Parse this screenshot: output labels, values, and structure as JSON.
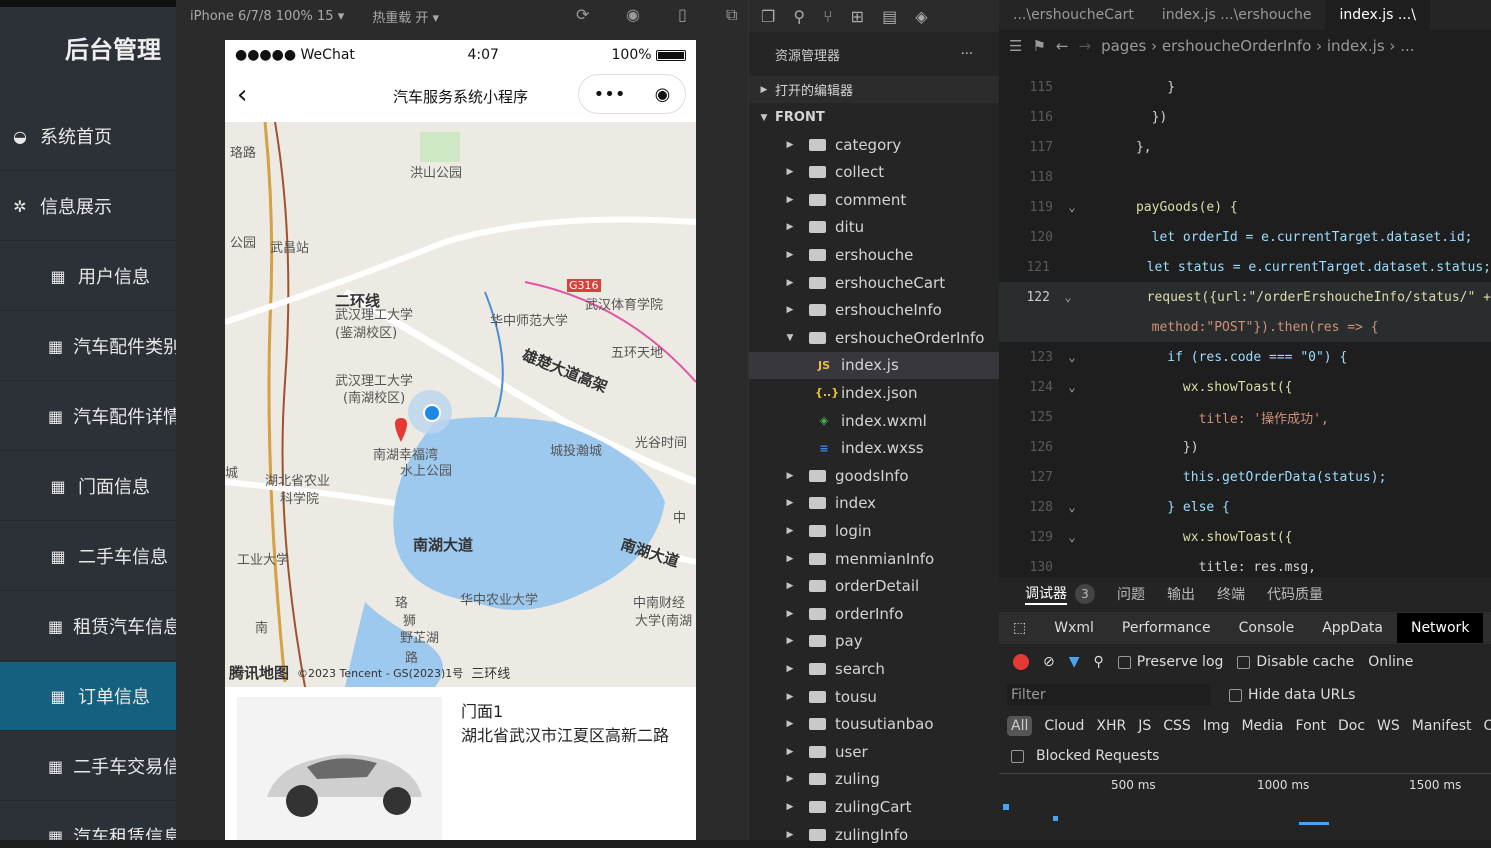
{
  "admin": {
    "title": "后台管理",
    "menu": [
      {
        "label": "系统首页",
        "icon": "dashboard-icon"
      },
      {
        "label": "信息展示",
        "icon": "puzzle-icon"
      },
      {
        "label": "用户信息",
        "icon": "table-icon"
      },
      {
        "label": "汽车配件类别",
        "icon": "table-icon"
      },
      {
        "label": "汽车配件详情",
        "icon": "table-icon"
      },
      {
        "label": "门面信息",
        "icon": "table-icon"
      },
      {
        "label": "二手车信息",
        "icon": "table-icon"
      },
      {
        "label": "租赁汽车信息",
        "icon": "table-icon"
      },
      {
        "label": "订单信息",
        "icon": "table-icon",
        "active": true
      },
      {
        "label": "二手车交易信息",
        "icon": "table-icon"
      },
      {
        "label": "汽车租赁信息",
        "icon": "table-icon"
      }
    ]
  },
  "simulator": {
    "device": "iPhone 6/7/8 100% 15 ▾",
    "hotreload": "热重载 开 ▾"
  },
  "phone": {
    "carrier": "●●●●● WeChat",
    "time": "4:07",
    "battery": "100%",
    "nav_title": "汽车服务系统小程序",
    "map_labels": [
      "洪山公园",
      "武昌站",
      "二环线",
      "武汉理工大学",
      "(鉴湖校区)",
      "华中师范大学",
      "G316",
      "武汉体育学院",
      "雄楚大道高架",
      "五环天地",
      "武汉理工大学",
      "(南湖校区)",
      "南湖幸福湾",
      "水上公园",
      "城投瀚城",
      "光谷时间",
      "湖北省农业",
      "科学院",
      "南湖大道",
      "南湖大道",
      "华中农业大学",
      "中南财经",
      "大学(南湖",
      "野芷湖",
      "工业大学",
      "珞",
      "狮",
      "南",
      "路",
      "公园",
      "珞路",
      "城",
      "中"
    ],
    "map_brand": "腾讯地图",
    "map_copyright": "©2023 Tencent - GS(2023)1号",
    "map_road_bottom": "三环线",
    "store_name": "门面1",
    "store_address": "湖北省武汉市江夏区高新二路"
  },
  "explorer": {
    "title": "资源管理器",
    "open_editors": "打开的编辑器",
    "root": "FRONT",
    "items": [
      {
        "label": "category",
        "type": "folder",
        "open": false,
        "depth": 1
      },
      {
        "label": "collect",
        "type": "folder",
        "open": false,
        "depth": 1
      },
      {
        "label": "comment",
        "type": "folder",
        "open": false,
        "depth": 1
      },
      {
        "label": "ditu",
        "type": "folder",
        "open": false,
        "depth": 1
      },
      {
        "label": "ershouche",
        "type": "folder",
        "open": false,
        "depth": 1
      },
      {
        "label": "ershoucheCart",
        "type": "folder",
        "open": false,
        "depth": 1
      },
      {
        "label": "ershoucheInfo",
        "type": "folder",
        "open": false,
        "depth": 1
      },
      {
        "label": "ershoucheOrderInfo",
        "type": "folder",
        "open": true,
        "depth": 1
      },
      {
        "label": "index.js",
        "type": "js",
        "depth": 2,
        "selected": true
      },
      {
        "label": "index.json",
        "type": "json",
        "depth": 2
      },
      {
        "label": "index.wxml",
        "type": "wxml",
        "depth": 2
      },
      {
        "label": "index.wxss",
        "type": "wxss",
        "depth": 2
      },
      {
        "label": "goodsInfo",
        "type": "folder",
        "open": false,
        "depth": 1
      },
      {
        "label": "index",
        "type": "folder",
        "open": false,
        "depth": 1
      },
      {
        "label": "login",
        "type": "folder",
        "open": false,
        "depth": 1
      },
      {
        "label": "menmianInfo",
        "type": "folder",
        "open": false,
        "depth": 1
      },
      {
        "label": "orderDetail",
        "type": "folder",
        "open": false,
        "depth": 1
      },
      {
        "label": "orderInfo",
        "type": "folder",
        "open": false,
        "depth": 1
      },
      {
        "label": "pay",
        "type": "folder",
        "open": false,
        "depth": 1
      },
      {
        "label": "search",
        "type": "folder",
        "open": false,
        "depth": 1
      },
      {
        "label": "tousu",
        "type": "folder",
        "open": false,
        "depth": 1
      },
      {
        "label": "tousutianbao",
        "type": "folder",
        "open": false,
        "depth": 1
      },
      {
        "label": "user",
        "type": "folder",
        "open": false,
        "depth": 1
      },
      {
        "label": "zuling",
        "type": "folder",
        "open": false,
        "depth": 1
      },
      {
        "label": "zulingCart",
        "type": "folder",
        "open": false,
        "depth": 1
      },
      {
        "label": "zulingInfo",
        "type": "folder",
        "open": false,
        "depth": 1
      }
    ]
  },
  "editor": {
    "tabs": [
      {
        "label": "...\\ershoucheCart"
      },
      {
        "label": "index.js ...\\ershouche"
      },
      {
        "label": "index.js ...\\",
        "active": true
      }
    ],
    "breadcrumb": [
      "pages",
      "ershoucheOrderInfo",
      "index.js",
      "..."
    ],
    "lines": [
      {
        "n": "115",
        "code": "          }"
      },
      {
        "n": "116",
        "code": "        })"
      },
      {
        "n": "117",
        "code": "      },"
      },
      {
        "n": "118",
        "code": ""
      },
      {
        "n": "119",
        "code": "      payGoods(e) {",
        "fold": true
      },
      {
        "n": "120",
        "code": "        let orderId = e.currentTarget.dataset.id;"
      },
      {
        "n": "121",
        "code": "        let status = e.currentTarget.dataset.status;"
      },
      {
        "n": "122",
        "code": "        request({url:\"/orderErshoucheInfo/status/\" +",
        "fold": true,
        "current": true
      },
      {
        "n": "",
        "code": "        method:\"POST\"}).then(res => {",
        "current": true
      },
      {
        "n": "123",
        "code": "          if (res.code === \"0\") {",
        "fold": true
      },
      {
        "n": "124",
        "code": "            wx.showToast({",
        "fold": true
      },
      {
        "n": "125",
        "code": "              title: '操作成功',"
      },
      {
        "n": "126",
        "code": "            })"
      },
      {
        "n": "127",
        "code": "            this.getOrderData(status);"
      },
      {
        "n": "128",
        "code": "          } else {",
        "fold": true
      },
      {
        "n": "129",
        "code": "            wx.showToast({",
        "fold": true
      },
      {
        "n": "130",
        "code": "              title: res.msg,"
      }
    ]
  },
  "devtools": {
    "tabs": [
      "调试器",
      "3",
      "问题",
      "输出",
      "终端",
      "代码质量"
    ],
    "panels": [
      "Wxml",
      "Performance",
      "Console",
      "AppData",
      "Network"
    ],
    "active_panel": "Network",
    "preserve_log": "Preserve log",
    "disable_cache": "Disable cache",
    "online": "Online",
    "filter_placeholder": "Filter",
    "hide_data_urls": "Hide data URLs",
    "types": [
      "All",
      "Cloud",
      "XHR",
      "JS",
      "CSS",
      "Img",
      "Media",
      "Font",
      "Doc",
      "WS",
      "Manifest",
      "O"
    ],
    "blocked_requests": "Blocked Requests",
    "ticks": [
      "500 ms",
      "1000 ms",
      "1500 ms"
    ]
  }
}
